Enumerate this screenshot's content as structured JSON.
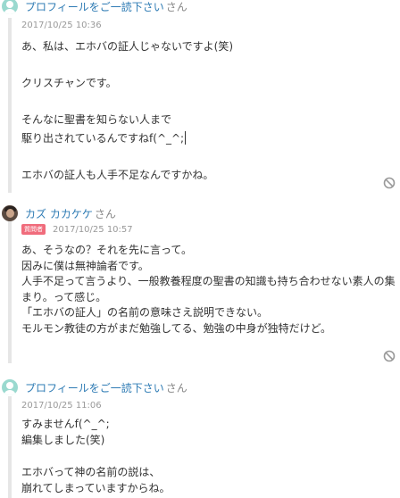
{
  "comments": [
    {
      "author": "プロフィールをご一読下さい",
      "author_suffix": "さん",
      "avatar": "default-avatar-icon",
      "badge": "",
      "date": "2017/10/25 10:36",
      "lines": [
        "あ、私は、エホバの証人じゃないですよ(笑)",
        "",
        "クリスチャンです。",
        "",
        "そんなに聖書を知らない人まで",
        "駆り出されているんですねf(^_^;",
        "",
        "エホバの証人も人手不足なんですかね。"
      ]
    },
    {
      "author": "カズ カカケケ",
      "author_suffix": "さん",
      "avatar": "user-photo-avatar",
      "badge": "質問者",
      "date": "2017/10/25 10:57",
      "lines": [
        "あ、そうなの？それを先に言って。",
        "因みに僕は無神論者です。",
        "人手不足って言うより、一般教養程度の聖書の知識も持ち合わせない素人の集",
        "まり。って感じ。",
        "「エホバの証人」の名前の意味さえ説明できない。",
        "モルモン教徒の方がまだ勉強してる、勉強の中身が独特だけど。"
      ]
    },
    {
      "author": "プロフィールをご一読下さい",
      "author_suffix": "さん",
      "avatar": "default-avatar-icon",
      "badge": "",
      "date": "2017/10/25 11:06",
      "lines": [
        "すみませんf(^_^;",
        "編集しました(笑)",
        "",
        "エホバって神の名前の説は、",
        "崩れてしまっていますからね。"
      ]
    }
  ],
  "colors": {
    "author_link": "#2e7bb4",
    "badge": "#f06c7c",
    "date": "#999999",
    "thread_line": "#e6e6e6"
  }
}
